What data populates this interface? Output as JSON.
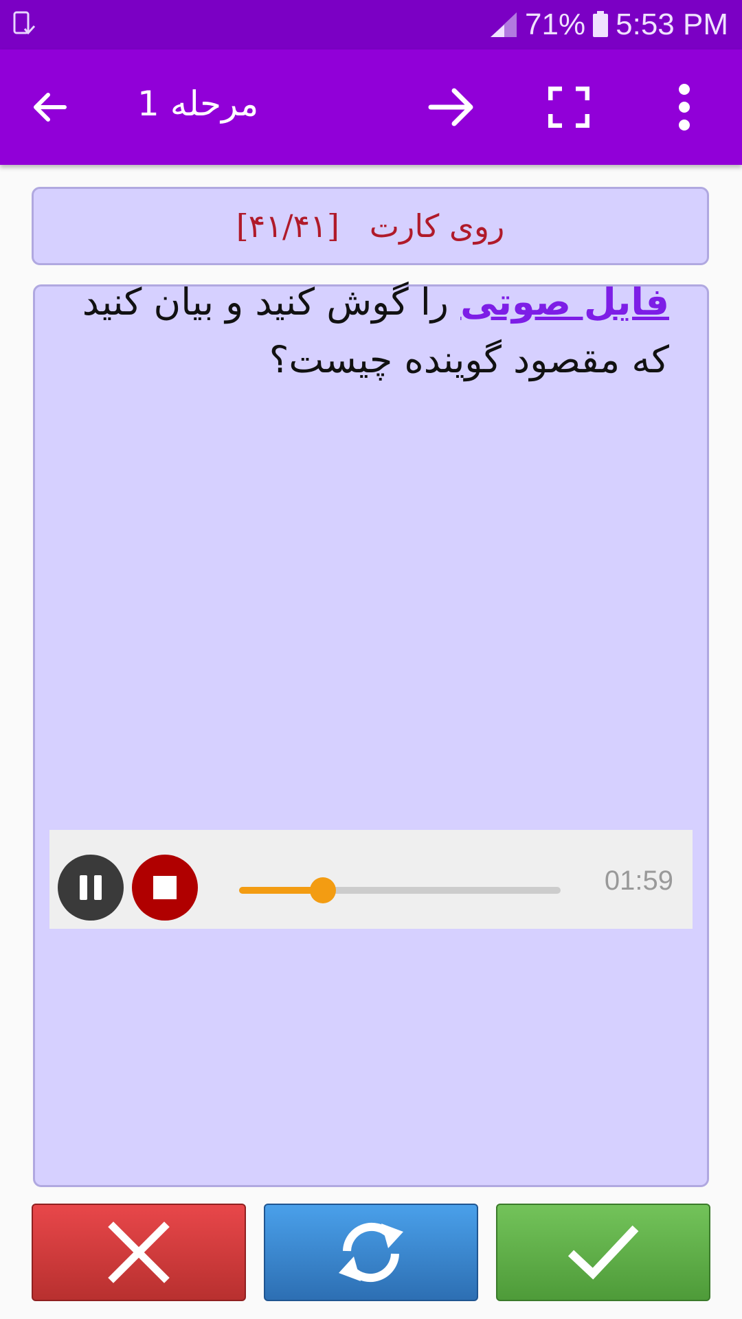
{
  "status_bar": {
    "battery": "71%",
    "time": "5:53 PM"
  },
  "app_bar": {
    "title": "مرحله 1"
  },
  "card": {
    "side_label": "روی کارت",
    "counter": "[۴۱/۴۱]",
    "question_link": "فایل صوتی",
    "question_rest": " را گوش کنید و بیان کنید که مقصود گوینده چیست؟"
  },
  "player": {
    "time": "01:59",
    "progress": 0.26
  },
  "colors": {
    "status": "#7b00c4",
    "app_bar": "#9100d8",
    "card_bg": "#d6d0ff",
    "link": "#7d1ee6",
    "seek": "#f39c12",
    "wrong": "#d23b3d",
    "flip": "#3a86d0",
    "right": "#5fb048"
  }
}
